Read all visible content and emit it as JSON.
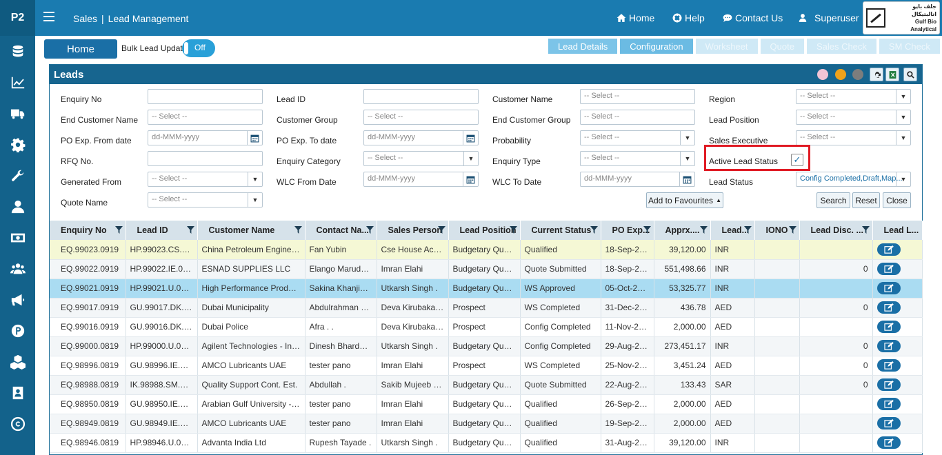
{
  "app": {
    "logo": "P2"
  },
  "header": {
    "module": "Sales",
    "page": "Lead Management",
    "nav": [
      {
        "label": "Home",
        "icon": "home-icon"
      },
      {
        "label": "Help",
        "icon": "help-icon"
      },
      {
        "label": "Contact Us",
        "icon": "chat-icon"
      },
      {
        "label": "Superuser",
        "icon": "user-icon"
      }
    ],
    "brand": {
      "arabic": "جلف بايو انالبتيكال",
      "english": "Gulf Bio Analytical"
    }
  },
  "sidebar": {
    "icons": [
      "database-icon",
      "chart-line-icon",
      "truck-icon",
      "gear-icon",
      "wrench-icon",
      "user-icon",
      "money-icon",
      "users-icon",
      "megaphone-icon",
      "p-circle-icon",
      "cubes-icon",
      "contact-book-icon",
      "copyright-icon"
    ]
  },
  "toolbar": {
    "home_label": "Home",
    "bulk_label": "Bulk Lead Update",
    "toggle_label": "Off",
    "tabs": [
      {
        "label": "Lead Details",
        "state": "normal"
      },
      {
        "label": "Configuration",
        "state": "active"
      },
      {
        "label": "Worksheet",
        "state": "disabled"
      },
      {
        "label": "Quote",
        "state": "disabled"
      },
      {
        "label": "Sales Check",
        "state": "disabled"
      },
      {
        "label": "SM Check",
        "state": "disabled"
      }
    ]
  },
  "panel": {
    "title": "Leads",
    "colors": {
      "pink": "#f2c4d6",
      "orange": "#f0a21a",
      "gray": "#7d7d7d"
    }
  },
  "filters": {
    "enquiry_no": {
      "label": "Enquiry No",
      "value": ""
    },
    "lead_id": {
      "label": "Lead ID",
      "value": ""
    },
    "customer_name": {
      "label": "Customer Name",
      "placeholder": "-- Select --"
    },
    "region": {
      "label": "Region",
      "placeholder": "-- Select --"
    },
    "end_customer_name": {
      "label": "End Customer Name",
      "placeholder": "-- Select --"
    },
    "customer_group": {
      "label": "Customer Group",
      "placeholder": "-- Select --"
    },
    "end_customer_group": {
      "label": "End Customer Group",
      "placeholder": "-- Select --"
    },
    "lead_position": {
      "label": "Lead Position",
      "placeholder": "-- Select --"
    },
    "po_from": {
      "label": "PO Exp. From date",
      "placeholder": "dd-MMM-yyyy"
    },
    "po_to": {
      "label": "PO Exp. To date",
      "placeholder": "dd-MMM-yyyy"
    },
    "probability": {
      "label": "Probability",
      "placeholder": "-- Select --"
    },
    "sales_exec": {
      "label": "Sales Executive",
      "placeholder": "-- Select --"
    },
    "rfq": {
      "label": "RFQ No.",
      "value": ""
    },
    "enquiry_category": {
      "label": "Enquiry Category",
      "placeholder": "-- Select --"
    },
    "enquiry_type": {
      "label": "Enquiry Type",
      "placeholder": "-- Select --"
    },
    "active_status": {
      "label": "Active Lead Status",
      "checked": "✓"
    },
    "generated_from": {
      "label": "Generated From",
      "placeholder": "-- Select --"
    },
    "wlc_from": {
      "label": "WLC From Date",
      "placeholder": "dd-MMM-yyyy"
    },
    "wlc_to": {
      "label": "WLC To Date",
      "placeholder": "dd-MMM-yyyy"
    },
    "lead_status": {
      "label": "Lead Status",
      "value": "Config Completed,Draft,Map..."
    },
    "quote_name": {
      "label": "Quote Name",
      "placeholder": "-- Select --"
    }
  },
  "buttons": {
    "favourites": "Add to Favourites",
    "search": "Search",
    "reset": "Reset",
    "close": "Close"
  },
  "table": {
    "columns": [
      "Enquiry No",
      "Lead ID",
      "Customer Name",
      "Contact Na...",
      "Sales Person",
      "Lead Position",
      "Current Status",
      "PO Exp...",
      "Apprx....",
      "Lead...",
      "IONO",
      "Lead Disc. ...",
      "Lead L..."
    ],
    "rows": [
      {
        "enq": "EQ.99023.0919",
        "lead": "HP.99023.CS.0919",
        "cust": "China Petroleum Engineerin...",
        "contact": "Fan Yubin",
        "sales": "Cse House Accou...",
        "pos": "Budgetary Quote ...",
        "status": "Qualified",
        "po": "18-Sep-2019",
        "amt": "39,120.00",
        "cur": "INR",
        "iono": "",
        "disc": "",
        "style": "yellow"
      },
      {
        "enq": "EQ.99022.0919",
        "lead": "HP.99022.IE.0919",
        "cust": "ESNAD SUPPLIES LLC",
        "contact": "Elango Marudhap...",
        "sales": "Imran Elahi",
        "pos": "Budgetary Quote ...",
        "status": "Quote Submitted",
        "po": "18-Sep-2020",
        "amt": "551,498.66",
        "cur": "INR",
        "iono": "",
        "disc": "0",
        "style": "alt"
      },
      {
        "enq": "EQ.99021.0919",
        "lead": "HP.99021.U.0919",
        "cust": "High Performance Products ...",
        "contact": "Sakina Khanjiwala",
        "sales": "Utkarsh Singh .",
        "pos": "Budgetary Quote ...",
        "status": "WS Approved",
        "po": "05-Oct-2019",
        "amt": "53,325.77",
        "cur": "INR",
        "iono": "",
        "disc": "",
        "style": "sel"
      },
      {
        "enq": "EQ.99017.0919",
        "lead": "GU.99017.DK.0919",
        "cust": "Dubai Municipality",
        "contact": "Abdulrahman Mo...",
        "sales": "Deva Kirubakaran...",
        "pos": "Prospect",
        "status": "WS Completed",
        "po": "31-Dec-2019",
        "amt": "436.78",
        "cur": "AED",
        "iono": "",
        "disc": "0",
        "style": "alt"
      },
      {
        "enq": "EQ.99016.0919",
        "lead": "GU.99016.DK.0919",
        "cust": "Dubai Police",
        "contact": "Afra . .",
        "sales": "Deva Kirubakaran...",
        "pos": "Prospect",
        "status": "Config Completed",
        "po": "11-Nov-2019",
        "amt": "2,000.00",
        "cur": "AED",
        "iono": "",
        "disc": "",
        "style": "plain"
      },
      {
        "enq": "EQ.99000.0819",
        "lead": "HP.99000.U.0819",
        "cust": "Agilent Technologies - India",
        "contact": "Dinesh Bhardwaj ...",
        "sales": "Utkarsh Singh .",
        "pos": "Budgetary Quote ...",
        "status": "Config Completed",
        "po": "29-Aug-2019",
        "amt": "273,451.17",
        "cur": "INR",
        "iono": "",
        "disc": "0",
        "style": "alt"
      },
      {
        "enq": "EQ.98996.0819",
        "lead": "GU.98996.IE.0819",
        "cust": "AMCO Lubricants UAE",
        "contact": "tester pano",
        "sales": "Imran Elahi",
        "pos": "Prospect",
        "status": "WS Completed",
        "po": "25-Nov-2019",
        "amt": "3,451.24",
        "cur": "AED",
        "iono": "",
        "disc": "0",
        "style": "plain"
      },
      {
        "enq": "EQ.98988.0819",
        "lead": "IK.98988.SM.0819",
        "cust": "Quality Support Cont. Est.",
        "contact": "Abdullah .",
        "sales": "Sakib Mujeeb Em...",
        "pos": "Budgetary Quote ...",
        "status": "Quote Submitted",
        "po": "22-Aug-2019",
        "amt": "133.43",
        "cur": "SAR",
        "iono": "",
        "disc": "0",
        "style": "alt"
      },
      {
        "enq": "EQ.98950.0819",
        "lead": "GU.98950.IE.0819",
        "cust": "Arabian Gulf University - UAE",
        "contact": "tester pano",
        "sales": "Imran Elahi",
        "pos": "Budgetary Quote ...",
        "status": "Qualified",
        "po": "26-Sep-2019",
        "amt": "2,000.00",
        "cur": "AED",
        "iono": "",
        "disc": "",
        "style": "plain"
      },
      {
        "enq": "EQ.98949.0819",
        "lead": "GU.98949.IE.0819",
        "cust": "AMCO Lubricants UAE",
        "contact": "tester pano",
        "sales": "Imran Elahi",
        "pos": "Budgetary Quote ...",
        "status": "Qualified",
        "po": "19-Sep-2019",
        "amt": "2,000.00",
        "cur": "AED",
        "iono": "",
        "disc": "",
        "style": "alt"
      },
      {
        "enq": "EQ.98946.0819",
        "lead": "HP.98946.U.0819",
        "cust": "Advanta India Ltd",
        "contact": "Rupesh Tayade .",
        "sales": "Utkarsh Singh .",
        "pos": "Budgetary Quote ...",
        "status": "Qualified",
        "po": "31-Aug-2019",
        "amt": "39,120.00",
        "cur": "INR",
        "iono": "",
        "disc": "",
        "style": "plain"
      }
    ]
  }
}
